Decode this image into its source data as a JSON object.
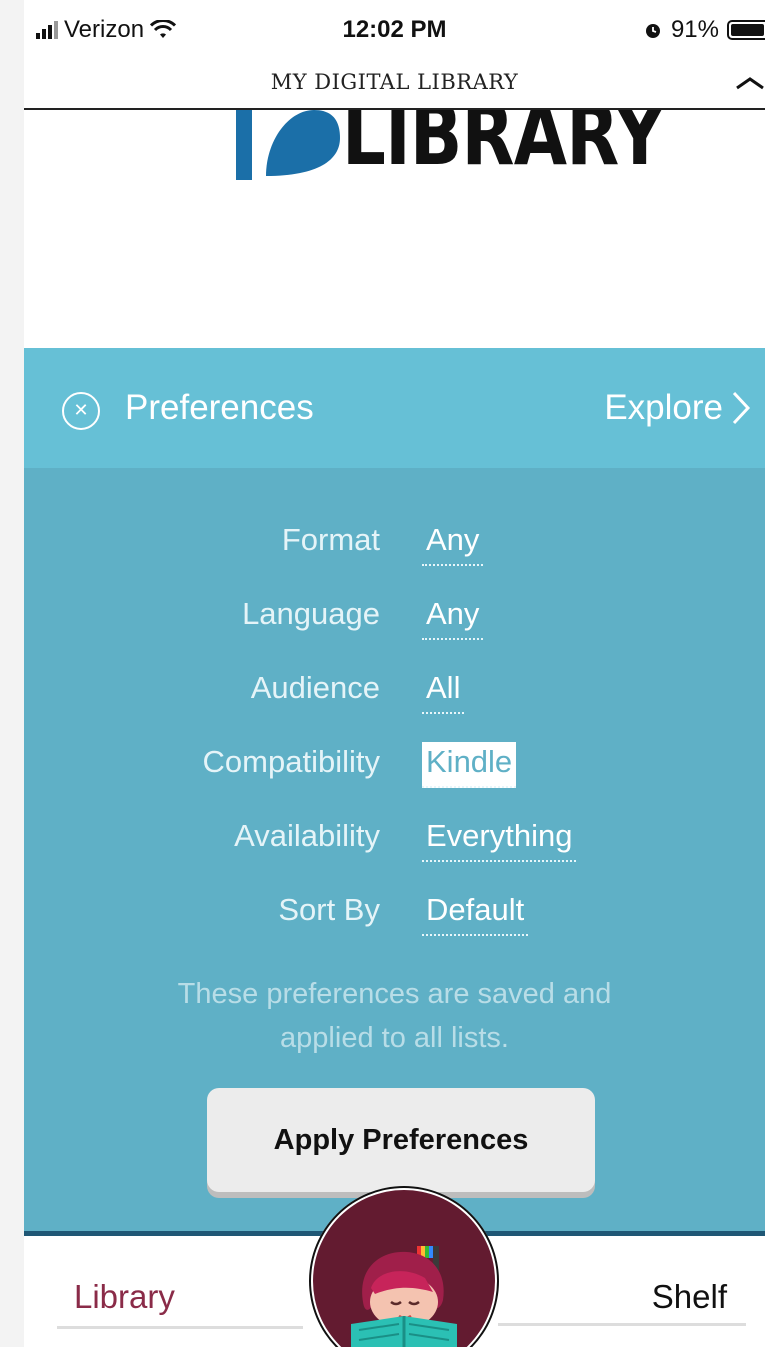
{
  "status_bar": {
    "carrier": "Verizon",
    "time": "12:02 PM",
    "battery": "91%",
    "battery_level": 0.91
  },
  "page": {
    "title": "MY DIGITAL LIBRARY"
  },
  "logo": {
    "text": "LIBRARY"
  },
  "preferences": {
    "header": {
      "label": "Preferences",
      "explore": "Explore"
    },
    "rows": [
      {
        "label": "Format",
        "value": "Any"
      },
      {
        "label": "Language",
        "value": "Any"
      },
      {
        "label": "Audience",
        "value": "All"
      },
      {
        "label": "Compatibility",
        "value": "Kindle"
      },
      {
        "label": "Availability",
        "value": "Everything"
      },
      {
        "label": "Sort By",
        "value": "Default"
      }
    ],
    "note": "These preferences are saved and applied to all lists.",
    "apply_label": "Apply Preferences"
  },
  "tabbar": {
    "library": "Library",
    "shelf": "Shelf"
  },
  "colors": {
    "header": "#66c0d6",
    "body": "#5fb0c6",
    "brand": "#8a2b48",
    "logo_blue": "#1b6fa8"
  },
  "icons": [
    "wifi-icon",
    "alarm-icon",
    "battery-icon",
    "chevron-up-icon",
    "close-circle-icon",
    "chevron-right-icon",
    "libby-avatar-icon"
  ]
}
